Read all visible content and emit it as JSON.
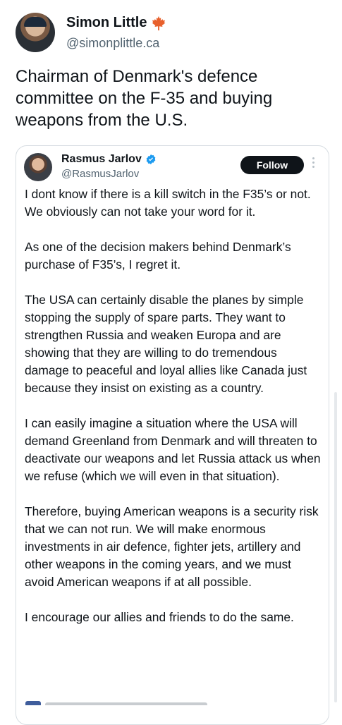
{
  "outer_tweet": {
    "author_name": "Simon Little",
    "handle": "@simonplittle.ca",
    "text": "Chairman of Denmark's defence committee on the F-35 and buying weapons from the U.S.",
    "flag_icon": "maple-leaf-icon",
    "accent_color": "#e8602c"
  },
  "quoted_tweet": {
    "author_name": "Rasmus Jarlov",
    "handle": "@RasmusJarlov",
    "follow_label": "Follow",
    "verified_icon": "verified-badge-icon",
    "verified_color": "#1d9bf0",
    "paragraphs": [
      "I dont know if there is a kill switch in the F35’s or not. We obviously can not take your word for it.",
      "As one of the decision makers behind Denmark’s purchase of F35’s, I regret it.",
      "The USA can certainly disable the planes by simple stopping the supply of spare parts. They want to strengthen Russia and weaken Europa and are showing that they are willing to do tremendous damage to peaceful and loyal allies like Canada just because they insist on existing as a country.",
      "I can easily imagine a situation where the USA will demand Greenland from Denmark and will threaten to deactivate our weapons and let Russia attack us when we refuse (which we will even in that situation).",
      "Therefore, buying American weapons is a security risk that we can not run. We will make enormous investments in air defence, fighter jets, artillery and other weapons in the coming years, and we must avoid American weapons if at all possible.",
      "I encourage our allies and friends to do the same."
    ]
  }
}
